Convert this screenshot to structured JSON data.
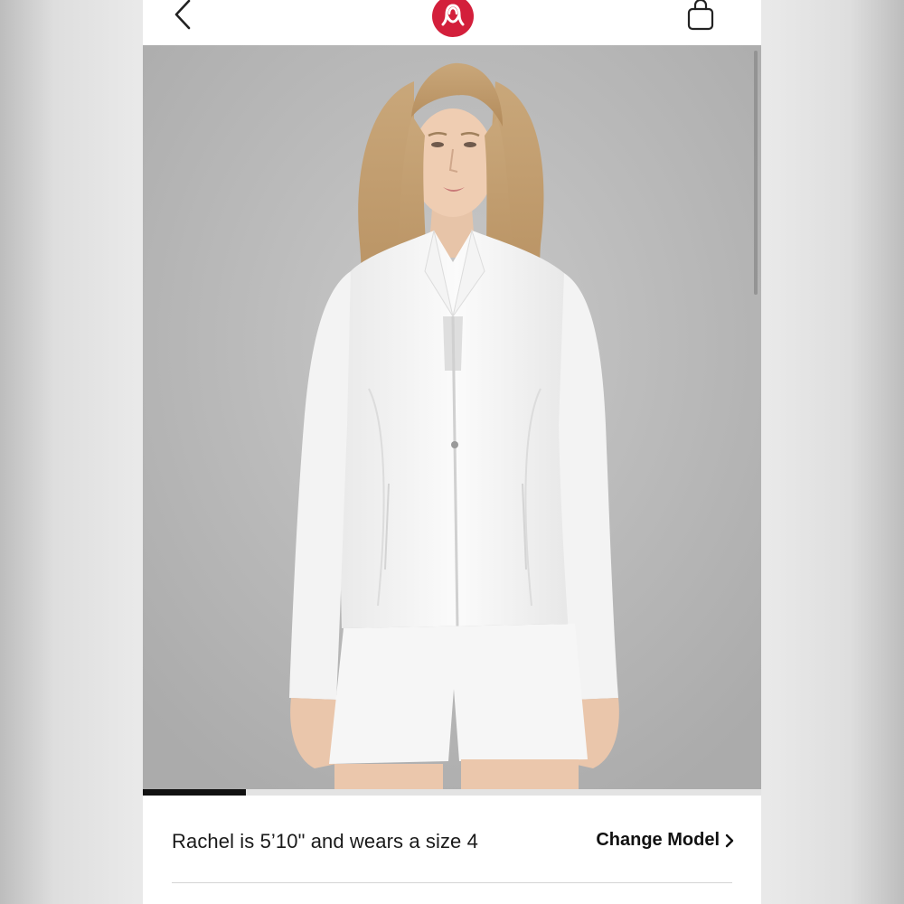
{
  "header": {
    "back_icon": "chevron-left-icon",
    "logo_icon": "lululemon-logo",
    "bag_icon": "shopping-bag-icon",
    "brand_color": "#d31f3b"
  },
  "gallery": {
    "image_alt": "Model wearing white zip-up jacket and white shorts",
    "current_index_fraction": 0.167
  },
  "model_info": {
    "text": "Rachel is 5’10\" and wears a size 4",
    "change_model_label": "Change Model",
    "change_model_icon": "chevron-right-icon"
  }
}
